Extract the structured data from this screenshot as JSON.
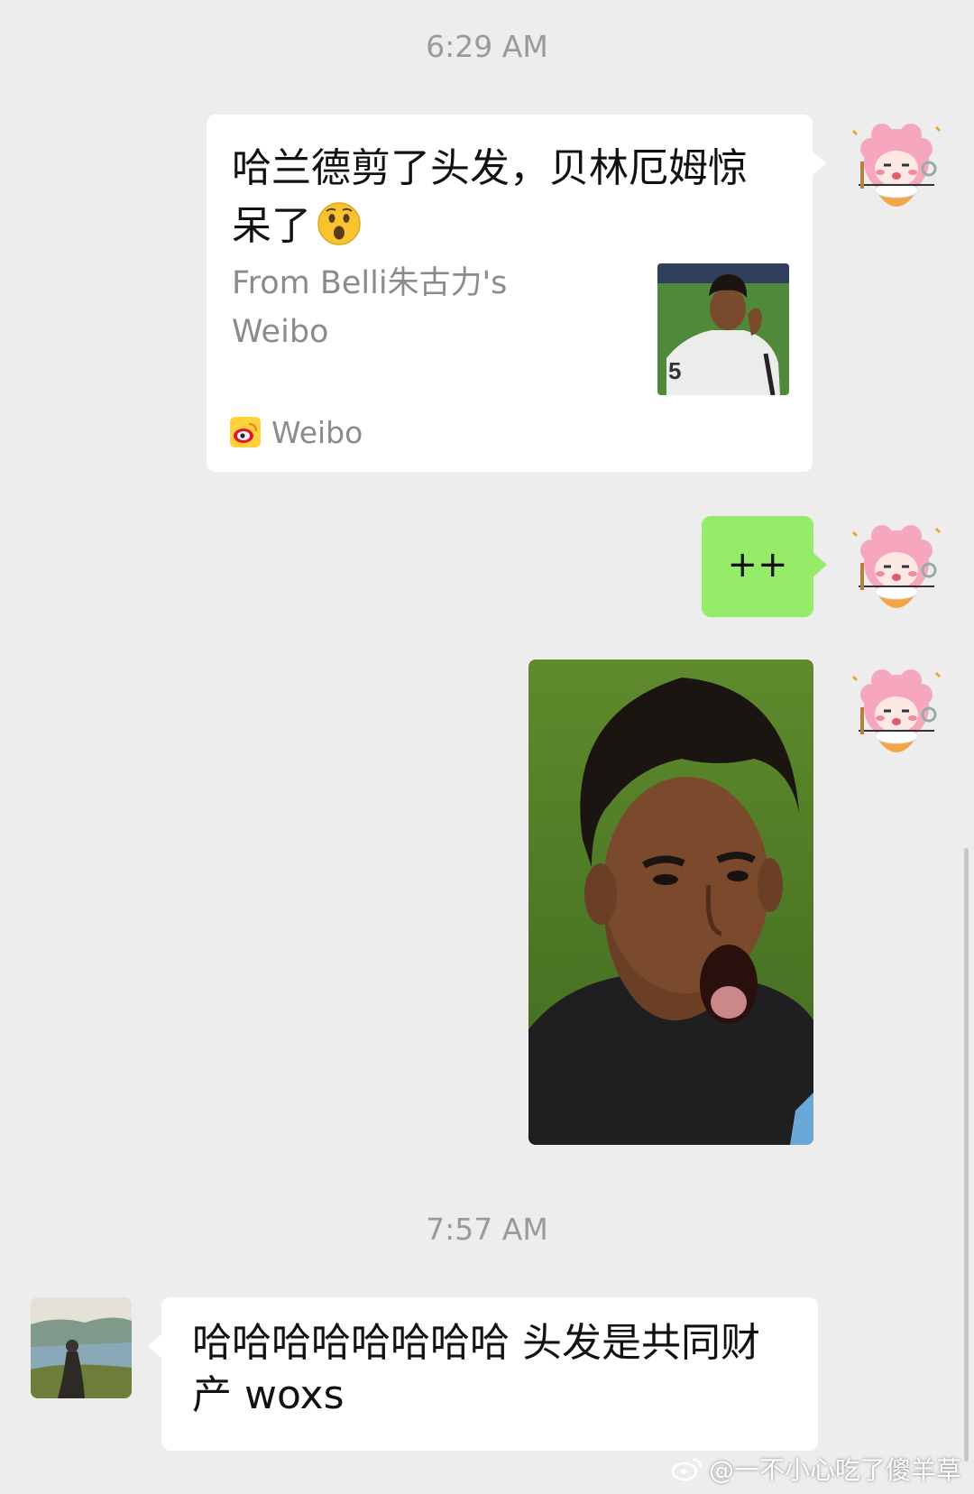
{
  "timestamps": [
    "6:29 AM",
    "7:57 AM"
  ],
  "shared_card": {
    "title": "哈兰德剪了头发，贝林厄姆惊呆了",
    "emoji": "astonished-face",
    "from": "From  Belli朱古力's Weibo",
    "source_app": "Weibo"
  },
  "sent_text": "++",
  "received_text": "哈哈哈哈哈哈哈哈 头发是共同财产 woxs",
  "watermark": "@一不小心吃了傻羊草",
  "colors": {
    "background": "#ededed",
    "sent_bubble": "#95ec69",
    "received_bubble": "#ffffff",
    "timestamp": "#9a9a9a"
  }
}
